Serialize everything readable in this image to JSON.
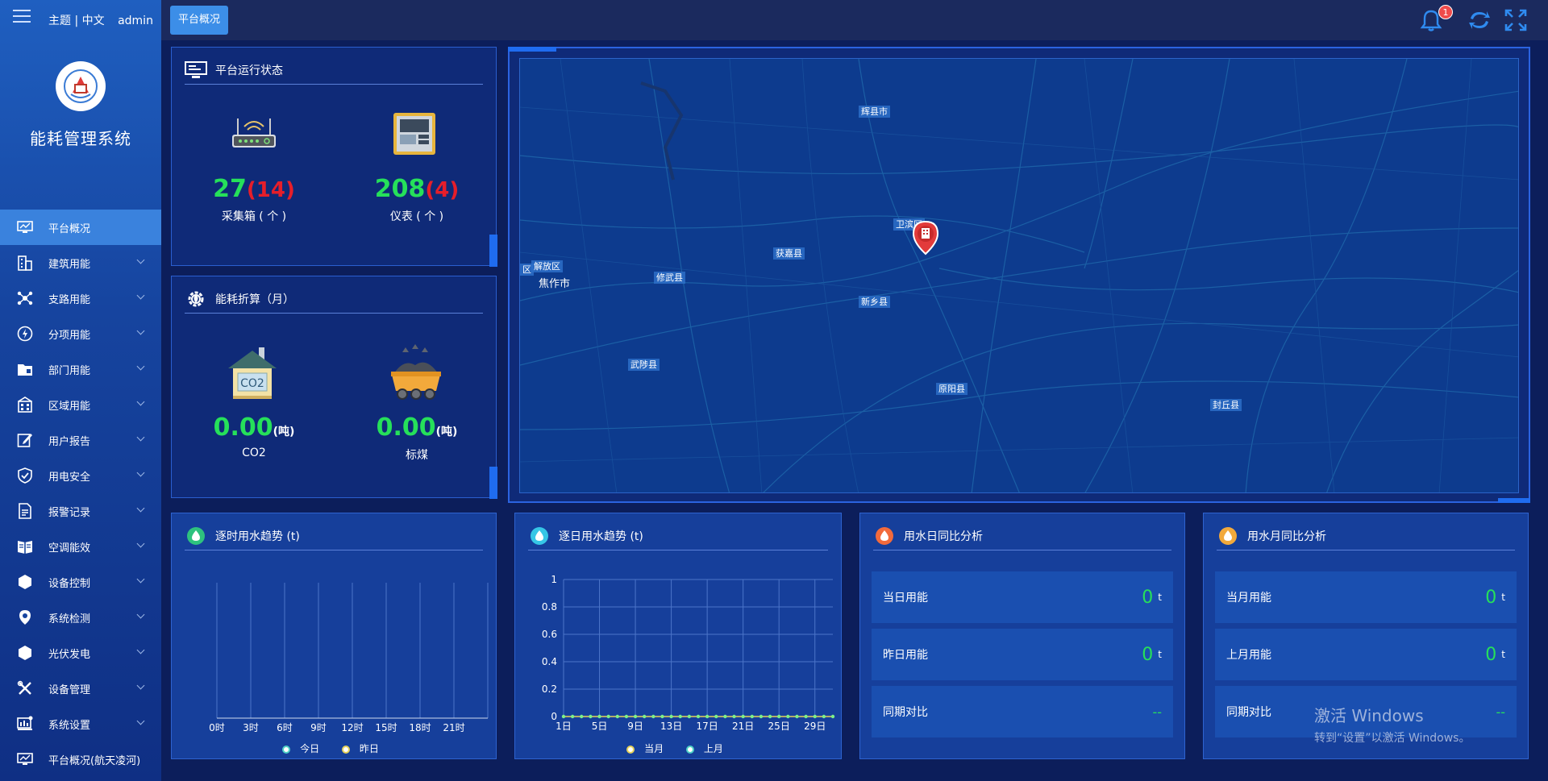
{
  "header": {
    "theme_lang": "主题 | 中文",
    "user": "admin",
    "active_tab": "平台概况",
    "notification_count": "1"
  },
  "sidebar": {
    "system_title": "能耗管理系统",
    "items": [
      {
        "label": "平台概况",
        "icon": "monitor-icon"
      },
      {
        "label": "建筑用能",
        "icon": "building-icon"
      },
      {
        "label": "支路用能",
        "icon": "branch-icon"
      },
      {
        "label": "分项用能",
        "icon": "lightning-icon"
      },
      {
        "label": "部门用能",
        "icon": "folder-icon"
      },
      {
        "label": "区域用能",
        "icon": "region-icon"
      },
      {
        "label": "用户报告",
        "icon": "edit-icon"
      },
      {
        "label": "用电安全",
        "icon": "shield-icon"
      },
      {
        "label": "报警记录",
        "icon": "document-icon"
      },
      {
        "label": "空调能效",
        "icon": "book-icon"
      },
      {
        "label": "设备控制",
        "icon": "hexagon-icon"
      },
      {
        "label": "系统检测",
        "icon": "location-icon"
      },
      {
        "label": "光伏发电",
        "icon": "hexagon-icon"
      },
      {
        "label": "设备管理",
        "icon": "tools-icon"
      },
      {
        "label": "系统设置",
        "icon": "settings-monitor-icon"
      },
      {
        "label": "平台概况(航天凌河)",
        "icon": "monitor-icon"
      }
    ]
  },
  "status_panel": {
    "title": "平台运行状态",
    "collector": {
      "value": "27",
      "sub": "(14)",
      "label": "采集箱 ( 个 )"
    },
    "meter": {
      "value": "208",
      "sub": "(4)",
      "label": "仪表 ( 个 )"
    }
  },
  "energy_panel": {
    "title": "能耗折算（月）",
    "co2": {
      "value": "0.00",
      "unit": "(吨)",
      "label": "CO2"
    },
    "coal": {
      "value": "0.00",
      "unit": "(吨)",
      "label": "标煤"
    }
  },
  "map": {
    "labels": [
      {
        "id": "huixian",
        "text": "辉县市"
      },
      {
        "id": "weibin",
        "text": "卫滨区"
      },
      {
        "id": "huojia",
        "text": "获嘉县"
      },
      {
        "id": "jiefang",
        "text": "解放区"
      },
      {
        "id": "qu",
        "text": "区"
      },
      {
        "id": "jiaozuo",
        "text": "焦作市"
      },
      {
        "id": "xiuwu",
        "text": "修武县"
      },
      {
        "id": "xinxiang",
        "text": "新乡县"
      },
      {
        "id": "wuzhi",
        "text": "武陟县"
      },
      {
        "id": "yuanyang",
        "text": "原阳县"
      },
      {
        "id": "fengqiu",
        "text": "封丘县"
      }
    ]
  },
  "hourly_water": {
    "title": "逐时用水趋势 (t)",
    "legend": [
      "今日",
      "昨日"
    ],
    "chart_data": {
      "type": "line",
      "categories": [
        "0时",
        "3时",
        "6时",
        "9时",
        "12时",
        "15时",
        "18时",
        "21时"
      ],
      "series": [
        {
          "name": "今日",
          "values": []
        },
        {
          "name": "昨日",
          "values": []
        }
      ],
      "colors": {
        "today": "#4fd1c5",
        "yesterday": "#e6d25a"
      }
    }
  },
  "daily_water": {
    "title": "逐日用水趋势 (t)",
    "legend": [
      "当月",
      "上月"
    ],
    "chart_data": {
      "type": "line",
      "ylim": [
        0,
        1
      ],
      "yticks": [
        "0",
        "0.2",
        "0.4",
        "0.6",
        "0.8",
        "1"
      ],
      "xticks": [
        "1日",
        "5日",
        "9日",
        "13日",
        "17日",
        "21日",
        "25日",
        "29日"
      ],
      "series": [
        {
          "name": "当月",
          "values": [
            0,
            0,
            0,
            0,
            0,
            0,
            0,
            0,
            0,
            0,
            0,
            0,
            0,
            0,
            0,
            0,
            0,
            0,
            0,
            0,
            0,
            0,
            0,
            0,
            0,
            0,
            0,
            0,
            0,
            0,
            0
          ]
        },
        {
          "name": "上月",
          "values": []
        }
      ],
      "colors": {
        "current": "#e6d25a",
        "previous": "#4fd1c5",
        "point": "#7cf08a"
      }
    }
  },
  "daily_cmp": {
    "title": "用水日同比分析",
    "rows": [
      {
        "label": "当日用能",
        "value": "0",
        "unit": "t"
      },
      {
        "label": "昨日用能",
        "value": "0",
        "unit": "t"
      },
      {
        "label": "同期对比",
        "value": "--",
        "unit": ""
      }
    ]
  },
  "monthly_cmp": {
    "title": "用水月同比分析",
    "rows": [
      {
        "label": "当月用能",
        "value": "0",
        "unit": "t"
      },
      {
        "label": "上月用能",
        "value": "0",
        "unit": "t"
      },
      {
        "label": "同期对比",
        "value": "--",
        "unit": ""
      }
    ]
  },
  "windows_watermark": {
    "line1": "激活 Windows",
    "line2": "转到“设置”以激活 Windows。"
  }
}
